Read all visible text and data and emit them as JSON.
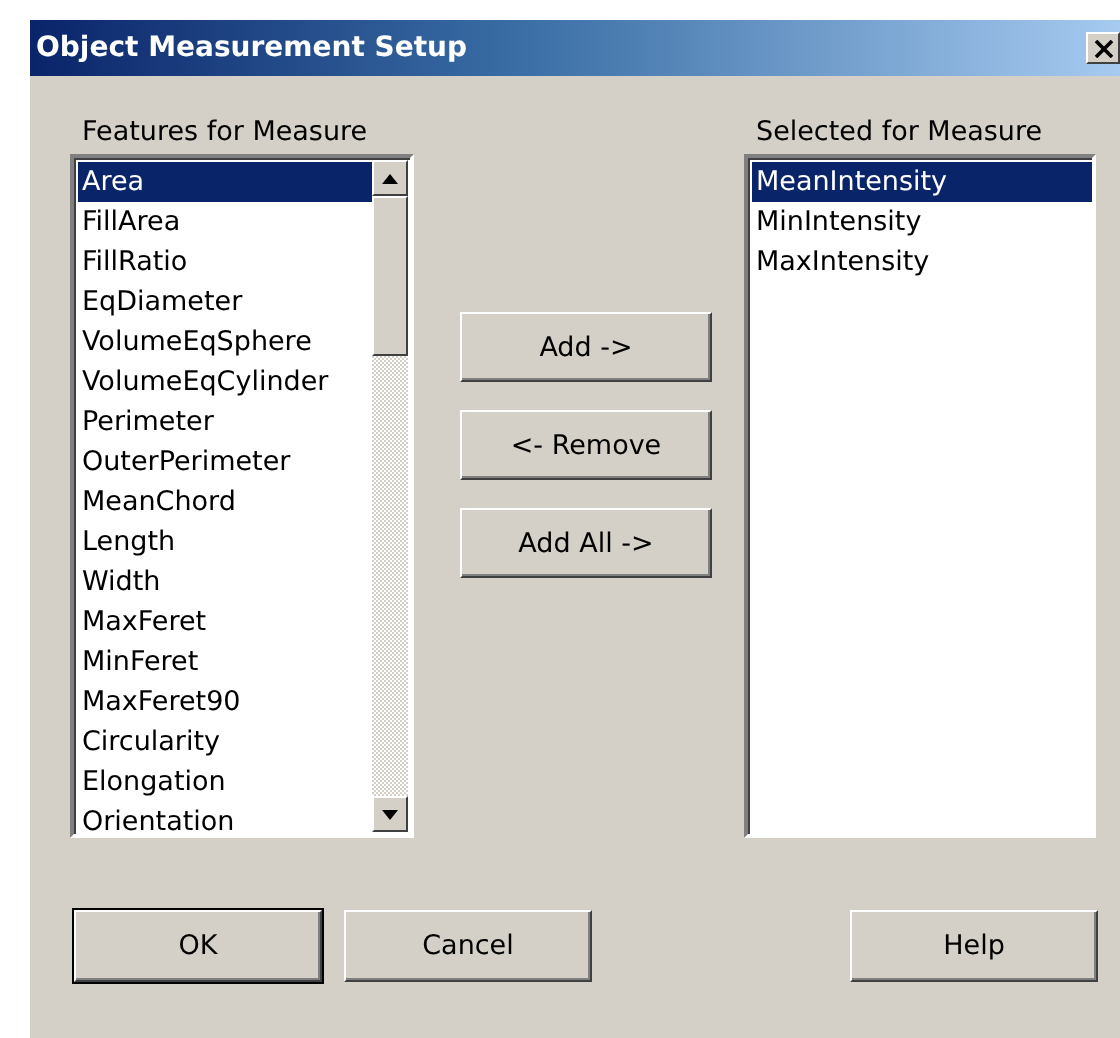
{
  "window": {
    "title": "Object Measurement Setup"
  },
  "features": {
    "label": "Features for Measure",
    "items": [
      {
        "text": "Area",
        "selected": true
      },
      {
        "text": "FillArea",
        "selected": false
      },
      {
        "text": "FillRatio",
        "selected": false
      },
      {
        "text": "EqDiameter",
        "selected": false
      },
      {
        "text": "VolumeEqSphere",
        "selected": false
      },
      {
        "text": "VolumeEqCylinder",
        "selected": false
      },
      {
        "text": "Perimeter",
        "selected": false
      },
      {
        "text": "OuterPerimeter",
        "selected": false
      },
      {
        "text": "MeanChord",
        "selected": false
      },
      {
        "text": "Length",
        "selected": false
      },
      {
        "text": "Width",
        "selected": false
      },
      {
        "text": "MaxFeret",
        "selected": false
      },
      {
        "text": "MinFeret",
        "selected": false
      },
      {
        "text": "MaxFeret90",
        "selected": false
      },
      {
        "text": "Circularity",
        "selected": false
      },
      {
        "text": "Elongation",
        "selected": false
      },
      {
        "text": "Orientation",
        "selected": false
      }
    ]
  },
  "move_buttons": [
    "Add ->",
    "<- Remove",
    "Add All ->"
  ],
  "selected": {
    "label": "Selected for Measure",
    "items": [
      {
        "text": "MeanIntensity",
        "selected": true
      },
      {
        "text": "MinIntensity",
        "selected": false
      },
      {
        "text": "MaxIntensity",
        "selected": false
      }
    ]
  },
  "buttons": [
    {
      "label": "OK",
      "default": true
    },
    {
      "label": "Cancel",
      "default": false
    },
    {
      "label": "Help",
      "default": false
    }
  ]
}
